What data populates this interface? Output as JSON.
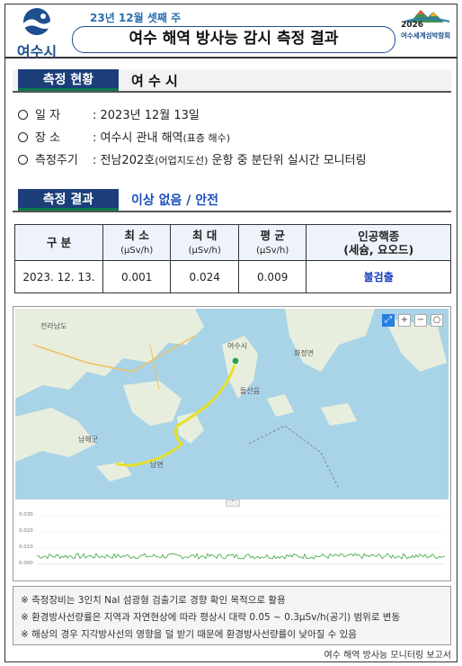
{
  "header": {
    "subtitle": "23년 12월 셋째 주",
    "title": "여수 해역 방사능 감시 측정 결과",
    "city_logo_text": "여수시",
    "expo_year": "2026",
    "expo_name": "여수세계섬박람회"
  },
  "status_section": {
    "label": "측정 현황",
    "value": "여 수 시"
  },
  "info": [
    {
      "key": "일    자",
      "value": ": 2023년 12월 13일"
    },
    {
      "key": "장    소",
      "value": ": 여수시 관내 해역",
      "note": "(표층 해수)"
    },
    {
      "key": "측정주기",
      "value": ": 전남202호",
      "note": "(어업지도선)",
      "value2": " 운항 중 분단위 실시간 모니터링"
    }
  ],
  "result_section": {
    "label": "측정 결과",
    "value": "이상 없음 / 안전"
  },
  "table": {
    "headers": [
      {
        "label": "구 분",
        "unit": ""
      },
      {
        "label": "최 소",
        "unit": "(μSv/h)"
      },
      {
        "label": "최 대",
        "unit": "(μSv/h)"
      },
      {
        "label": "평 균",
        "unit": "(μSv/h)"
      },
      {
        "label": "인공핵종",
        "unit": "(세슘, 요오드)"
      }
    ],
    "row": [
      "2023. 12. 13.",
      "0.001",
      "0.024",
      "0.009",
      "불검출"
    ]
  },
  "map": {
    "labels": [
      "전라남도",
      "여수시",
      "남해군",
      "돌산읍",
      "화정면",
      "남면"
    ],
    "plot_yticks": [
      "0.030",
      "0.020",
      "0.010",
      "0.000"
    ],
    "colors": {
      "sea": "#a9d4e7",
      "land": "#e8eedd",
      "track": "#e6e02a",
      "plot_line": "#3aa53a"
    }
  },
  "notes": [
    "※  측정장비는 3인치 NaI 섬광형 검출기로 경향 확인 목적으로 활용",
    "※  환경방사선량률은 지역과 자연현상에 따라 평상시 대략 0.05 ~ 0.3μSv/h(공기) 범위로 변동",
    "※  해상의 경우 지각방사선의 영향을 덜 받기 때문에 환경방사선량률이 낮아질 수 있음"
  ],
  "footer": "여수 해역 방사능 모니터링 보고서"
}
